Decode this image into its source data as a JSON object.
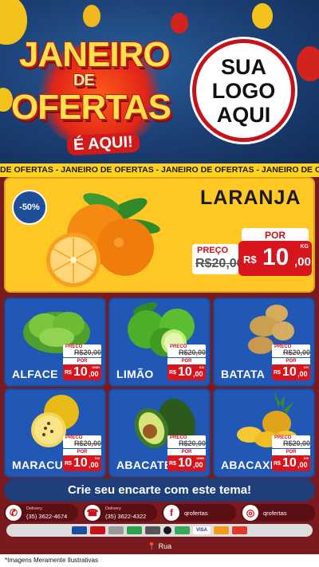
{
  "header": {
    "title_line1": "JANEIRO",
    "title_line2": "DE",
    "title_line3": "OFERTAS",
    "title_tag": "É AQUI!",
    "logo": [
      "SUA",
      "LOGO",
      "AQUI"
    ]
  },
  "ticker": "DE OFERTAS - JANEIRO DE OFERTAS - JANEIRO DE OFERTAS - JANEIRO DE OFERTAS - JANEIRO DE",
  "hero": {
    "discount": "-50%",
    "name": "LARANJA",
    "old_label": "PREÇO",
    "old_price": "R$20,00",
    "new_label": "POR",
    "currency": "R$",
    "price_int": "10",
    "price_cents": ",00",
    "unit": "KG"
  },
  "products": [
    {
      "name": "ALFACE",
      "old_label": "PRECO",
      "old_price": "R$20,00",
      "new_label": "POR",
      "currency": "R$",
      "price_int": "10",
      "price_cents": ",00",
      "unit": "UNID"
    },
    {
      "name": "LIMÃO",
      "old_label": "PRECO",
      "old_price": "R$20,00",
      "new_label": "POR",
      "currency": "R$",
      "price_int": "10",
      "price_cents": ",00",
      "unit": "KG"
    },
    {
      "name": "BATATA",
      "old_label": "PRECO",
      "old_price": "R$20,00",
      "new_label": "POR",
      "currency": "R$",
      "price_int": "10",
      "price_cents": ",00",
      "unit": "KG"
    },
    {
      "name": "MARACUJÁ",
      "old_label": "PRECO",
      "old_price": "R$20,00",
      "new_label": "POR",
      "currency": "R$",
      "price_int": "10",
      "price_cents": ",00",
      "unit": "KG"
    },
    {
      "name": "ABACATE",
      "old_label": "PRECO",
      "old_price": "R$20,00",
      "new_label": "POR",
      "currency": "R$",
      "price_int": "10",
      "price_cents": ",00",
      "unit": "UNID"
    },
    {
      "name": "ABACAXI",
      "old_label": "PRECO",
      "old_price": "R$20,00",
      "new_label": "POR",
      "currency": "R$",
      "price_int": "10",
      "price_cents": ",00",
      "unit": "KG"
    }
  ],
  "cta": "Crie seu encarte com este tema!",
  "contacts": [
    {
      "icon": "whatsapp-icon",
      "label": "Delivery",
      "value": "(35) 3622-4674"
    },
    {
      "icon": "phone-icon",
      "label": "Delivery",
      "value": "(35) 3622-4322"
    },
    {
      "icon": "facebook-icon",
      "label": "",
      "value": "qrofertas"
    },
    {
      "icon": "instagram-icon",
      "label": "",
      "value": "qrofertas"
    }
  ],
  "payments": [
    "VISA"
  ],
  "address": "Rua",
  "footer": "*Imagens Meramente Ilustrativas",
  "colors": {
    "brand_red": "#d8141c",
    "card_blue": "#2258b5",
    "hero_yellow": "#ffc825",
    "background": "#7a1a1f"
  }
}
